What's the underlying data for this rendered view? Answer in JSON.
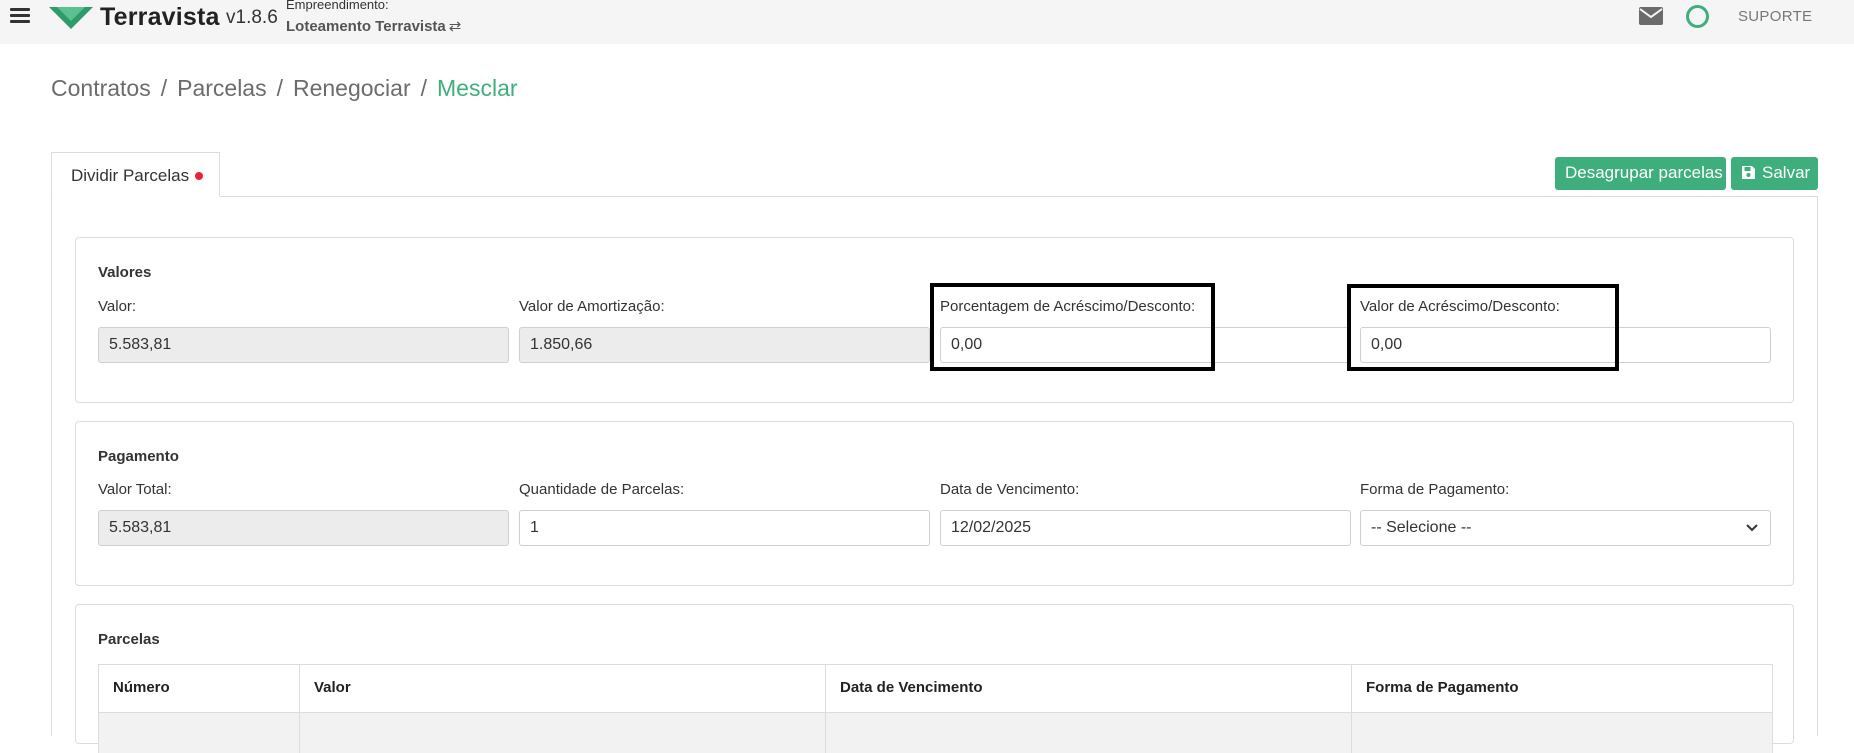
{
  "app": {
    "brand": "Terravista",
    "version": "v1.8.6",
    "empreendimento_label": "Empreendimento:",
    "empreendimento_value": "Loteamento Terravista",
    "support_label": "SUPORTE",
    "accent_color": "#3eaf7c"
  },
  "breadcrumb": [
    "Contratos",
    "Parcelas",
    "Renegociar",
    "Mesclar"
  ],
  "tab": {
    "label": "Dividir Parcelas",
    "indicator_color": "#e3263b"
  },
  "actions": {
    "desagrupar": "Desagrupar parcelas",
    "salvar": "Salvar"
  },
  "valores": {
    "title": "Valores",
    "valor_label": "Valor:",
    "valor_value": "5.583,81",
    "amortizacao_label": "Valor de Amortização:",
    "amortizacao_value": "1.850,66",
    "porcentagem_label": "Porcentagem de Acréscimo/Desconto:",
    "porcentagem_value": "0,00",
    "acrescimo_label": "Valor de Acréscimo/Desconto:",
    "acrescimo_value": "0,00"
  },
  "pagamento": {
    "title": "Pagamento",
    "total_label": "Valor Total:",
    "total_value": "5.583,81",
    "quantidade_label": "Quantidade de Parcelas:",
    "quantidade_value": "1",
    "vencimento_label": "Data de Vencimento:",
    "vencimento_value": "12/02/2025",
    "forma_label": "Forma de Pagamento:",
    "forma_value": "-- Selecione --"
  },
  "parcelas": {
    "title": "Parcelas",
    "columns": [
      "Número",
      "Valor",
      "Data de Vencimento",
      "Forma de Pagamento"
    ]
  }
}
